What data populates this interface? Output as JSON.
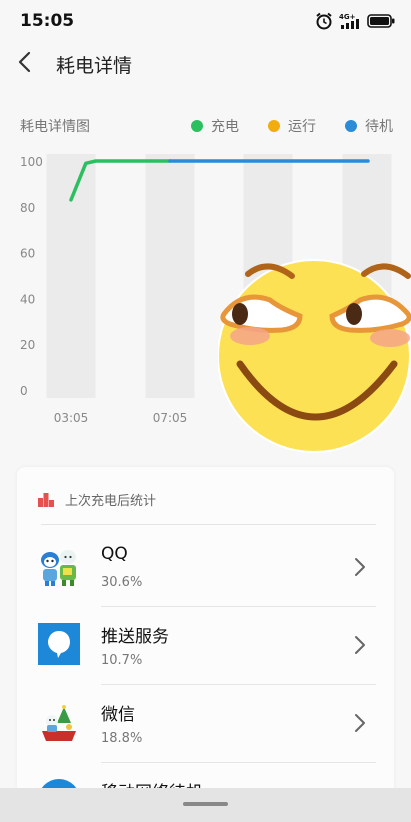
{
  "status_bar": {
    "time": "15:05",
    "network_label": "4G+",
    "battery_level": 1.0
  },
  "header": {
    "title": "耗电详情"
  },
  "chart_data": {
    "type": "line",
    "title": "耗电详情图",
    "legend": [
      {
        "name": "充电",
        "color": "#2bbf60"
      },
      {
        "name": "运行",
        "color": "#f1ac0e"
      },
      {
        "name": "待机",
        "color": "#2a8bd8"
      }
    ],
    "y_ticks": [
      "100",
      "80",
      "60",
      "40",
      "20",
      "0"
    ],
    "ylim": [
      0,
      100
    ],
    "x_tick_labels": [
      "03:05",
      "07:05"
    ],
    "series": [
      {
        "name": "充电",
        "color": "#2bbf60",
        "points": [
          [
            0.0,
            83
          ],
          [
            0.3,
            91
          ],
          [
            0.6,
            99
          ],
          [
            1.0,
            100
          ],
          [
            4.0,
            100
          ]
        ]
      },
      {
        "name": "待机",
        "color": "#2a8bd8",
        "points": [
          [
            4.0,
            100
          ],
          [
            12.0,
            100
          ]
        ]
      }
    ]
  },
  "stats_card": {
    "title": "上次充电后统计",
    "items": [
      {
        "name": "QQ",
        "percent": "30.6%",
        "icon": "qq-app-icon"
      },
      {
        "name": "推送服务",
        "percent": "10.7%",
        "icon": "push-service-icon"
      },
      {
        "name": "微信",
        "percent": "18.8%",
        "icon": "wechat-app-icon"
      },
      {
        "name": "移动网络待机",
        "percent": "",
        "icon": "mobile-network-icon"
      }
    ]
  }
}
